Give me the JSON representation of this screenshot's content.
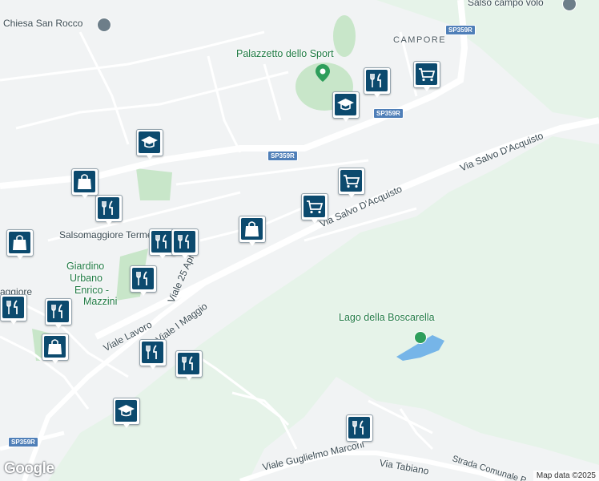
{
  "map": {
    "place_labels": {
      "chiesa": "Chiesa San Rocco",
      "salso_campo_volo": "Salso campo volo",
      "campore": "CAMPORE",
      "palazzetto": "Palazzetto dello Sport",
      "terme": "Salsomaggiore Terme",
      "giardino_1": "Giardino",
      "giardino_2": "Urbano",
      "giardino_3": "Enrico -",
      "giardino_4": "Mazzini",
      "lago": "Lago della Boscarella",
      "aggiore": "aggiore"
    },
    "street_labels": {
      "salvo_dacquisto_1": "Via Salvo D'Acquisto",
      "salvo_dacquisto_2": "Via Salvo D'Acquisto",
      "aprile": "Viale 25 Aprile",
      "lavoro": "Viale Lavoro",
      "maggio": "Viale I Maggio",
      "guglielmo": "Viale Guglielmo Marconi",
      "tabiano": "Via Tabiano",
      "strada_comunale": "Strada Comunale P"
    },
    "road_shields": {
      "sp359r_top": "SP359R",
      "sp359r_mid": "SP359R",
      "sp359r_left": "SP359R",
      "sp359r_bottom": "SP359R"
    },
    "markers": [
      {
        "type": "shopping-cart",
        "label": "supermarket"
      },
      {
        "type": "restaurant",
        "label": "restaurant"
      },
      {
        "type": "school",
        "label": "school"
      },
      {
        "type": "shopping-cart",
        "label": "supermarket"
      },
      {
        "type": "shopping-cart",
        "label": "supermarket"
      },
      {
        "type": "shopping-bag",
        "label": "shop"
      },
      {
        "type": "restaurant",
        "label": "restaurant"
      },
      {
        "type": "restaurant",
        "label": "restaurant"
      },
      {
        "type": "restaurant",
        "label": "restaurant"
      },
      {
        "type": "school",
        "label": "school"
      },
      {
        "type": "restaurant",
        "label": "restaurant"
      },
      {
        "type": "restaurant",
        "label": "restaurant"
      },
      {
        "type": "school",
        "label": "school"
      },
      {
        "type": "restaurant",
        "label": "restaurant"
      },
      {
        "type": "shopping-bag",
        "label": "shop"
      },
      {
        "type": "restaurant",
        "label": "restaurant"
      },
      {
        "type": "shopping-bag",
        "label": "shop"
      },
      {
        "type": "restaurant",
        "label": "restaurant"
      },
      {
        "type": "shopping-bag",
        "label": "shop"
      },
      {
        "type": "restaurant",
        "label": "restaurant"
      }
    ],
    "google_logo": "Google",
    "attribution": "Map data ©2025",
    "colors": {
      "land": "#e6f3e9",
      "urban": "#f1f3f4",
      "road": "#ffffff",
      "park": "#c8e6c9",
      "water": "#76b5e8",
      "marker": "#0c4a6e",
      "green_label": "#1f7a43"
    }
  }
}
